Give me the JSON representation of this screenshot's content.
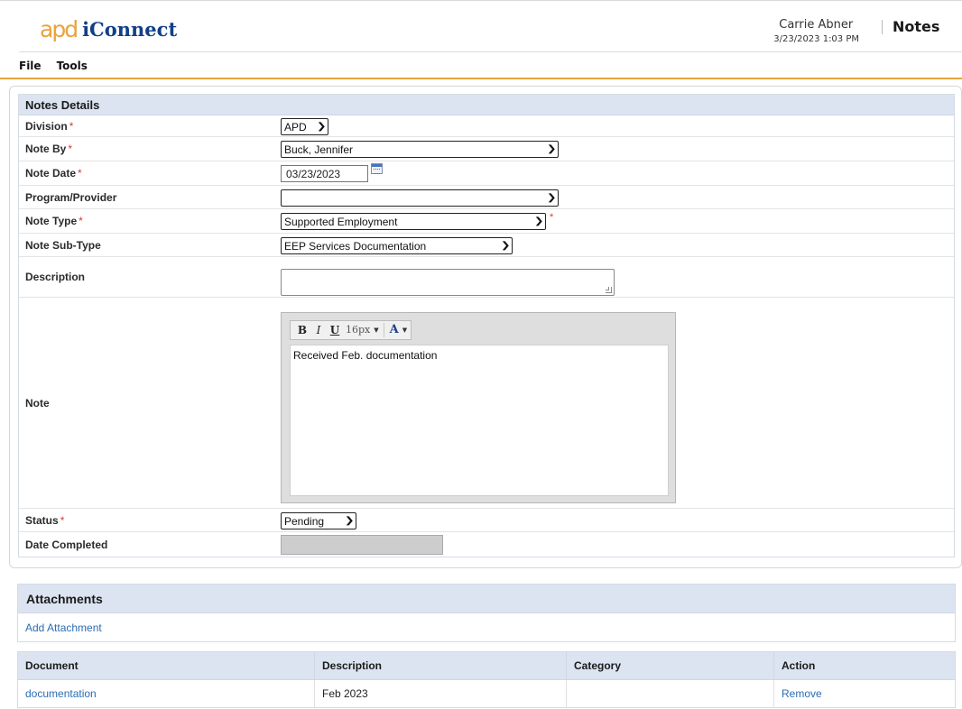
{
  "header": {
    "logo_apd": "apd",
    "logo_iconnect": "iConnect",
    "user_name": "Carrie Abner",
    "user_datetime": "3/23/2023 1:03 PM",
    "page_name": "Notes"
  },
  "menu": [
    {
      "label": "File"
    },
    {
      "label": "Tools"
    }
  ],
  "notes_details": {
    "title": "Notes Details",
    "required_marker": "*",
    "fields": {
      "division": {
        "label": "Division",
        "value": "APD"
      },
      "note_by": {
        "label": "Note By",
        "value": "Buck, Jennifer"
      },
      "note_date": {
        "label": "Note Date",
        "value": "03/23/2023"
      },
      "program_provider": {
        "label": "Program/Provider",
        "value": ""
      },
      "note_type": {
        "label": "Note Type",
        "value": "Supported Employment"
      },
      "note_sub_type": {
        "label": "Note Sub-Type",
        "value": "EEP Services Documentation"
      },
      "description": {
        "label": "Description",
        "value": ""
      },
      "note": {
        "label": "Note",
        "value": "Received Feb. documentation"
      },
      "status": {
        "label": "Status",
        "value": "Pending"
      },
      "date_completed": {
        "label": "Date Completed",
        "value": ""
      }
    },
    "editor_toolbar": {
      "bold": "B",
      "italic": "I",
      "underline": "U",
      "font_size": "16px",
      "font_color": "A"
    }
  },
  "attachments": {
    "title": "Attachments",
    "add_link": "Add Attachment",
    "columns": [
      "Document",
      "Description",
      "Category",
      "Action"
    ],
    "rows": [
      {
        "document": "documentation",
        "description": "Feb 2023",
        "category": "",
        "action": "Remove"
      }
    ]
  },
  "colors": {
    "accent_orange": "#e3a53b",
    "section_header": "#dbe4f0",
    "link_blue": "#2a6db3",
    "required_red": "#d23a3a",
    "logo_orange": "#e8a33d",
    "logo_navy": "#123f87"
  }
}
